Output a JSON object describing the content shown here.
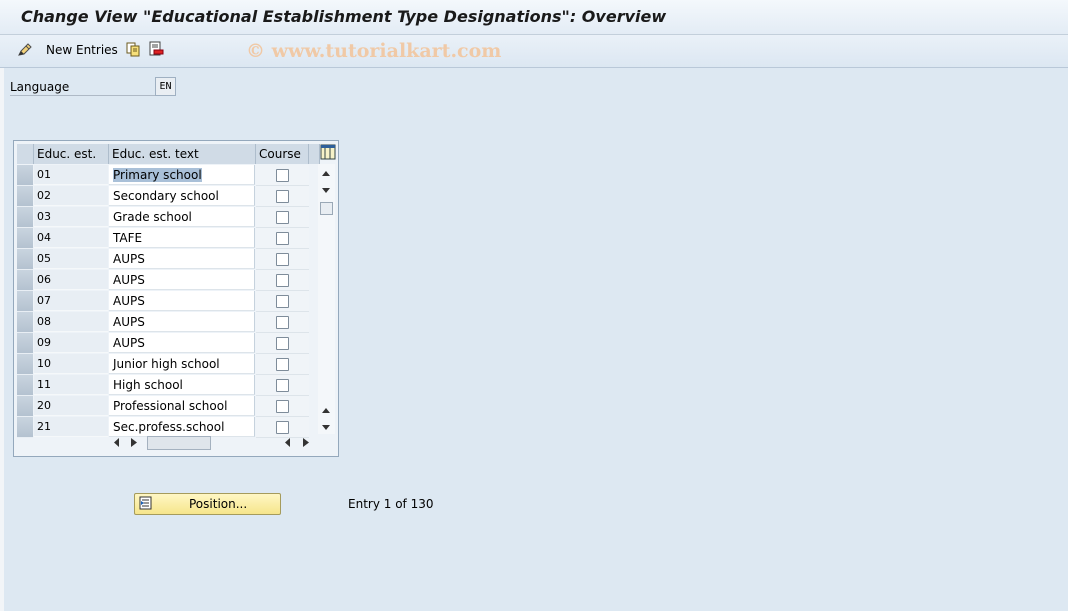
{
  "window": {
    "title": "Change View \"Educational Establishment Type Designations\": Overview"
  },
  "toolbar": {
    "new_entries_label": "New Entries",
    "watermark": "© www.tutorialkart.com"
  },
  "language": {
    "label": "Language",
    "value": "EN"
  },
  "table": {
    "columns": [
      "Educ. est.",
      "Educ. est. text",
      "Course"
    ],
    "rows": [
      {
        "code": "01",
        "text": "Primary school",
        "course": false
      },
      {
        "code": "02",
        "text": "Secondary school",
        "course": false
      },
      {
        "code": "03",
        "text": "Grade school",
        "course": false
      },
      {
        "code": "04",
        "text": "TAFE",
        "course": false
      },
      {
        "code": "05",
        "text": "AUPS",
        "course": false
      },
      {
        "code": "06",
        "text": "AUPS",
        "course": false
      },
      {
        "code": "07",
        "text": "AUPS",
        "course": false
      },
      {
        "code": "08",
        "text": "AUPS",
        "course": false
      },
      {
        "code": "09",
        "text": "AUPS",
        "course": false
      },
      {
        "code": "10",
        "text": "Junior high school",
        "course": false
      },
      {
        "code": "11",
        "text": "High school",
        "course": false
      },
      {
        "code": "20",
        "text": "Professional school",
        "course": false
      },
      {
        "code": "21",
        "text": "Sec.profess.school",
        "course": false
      }
    ]
  },
  "position_button": {
    "label": "Position..."
  },
  "entry_info": "Entry 1 of 130"
}
